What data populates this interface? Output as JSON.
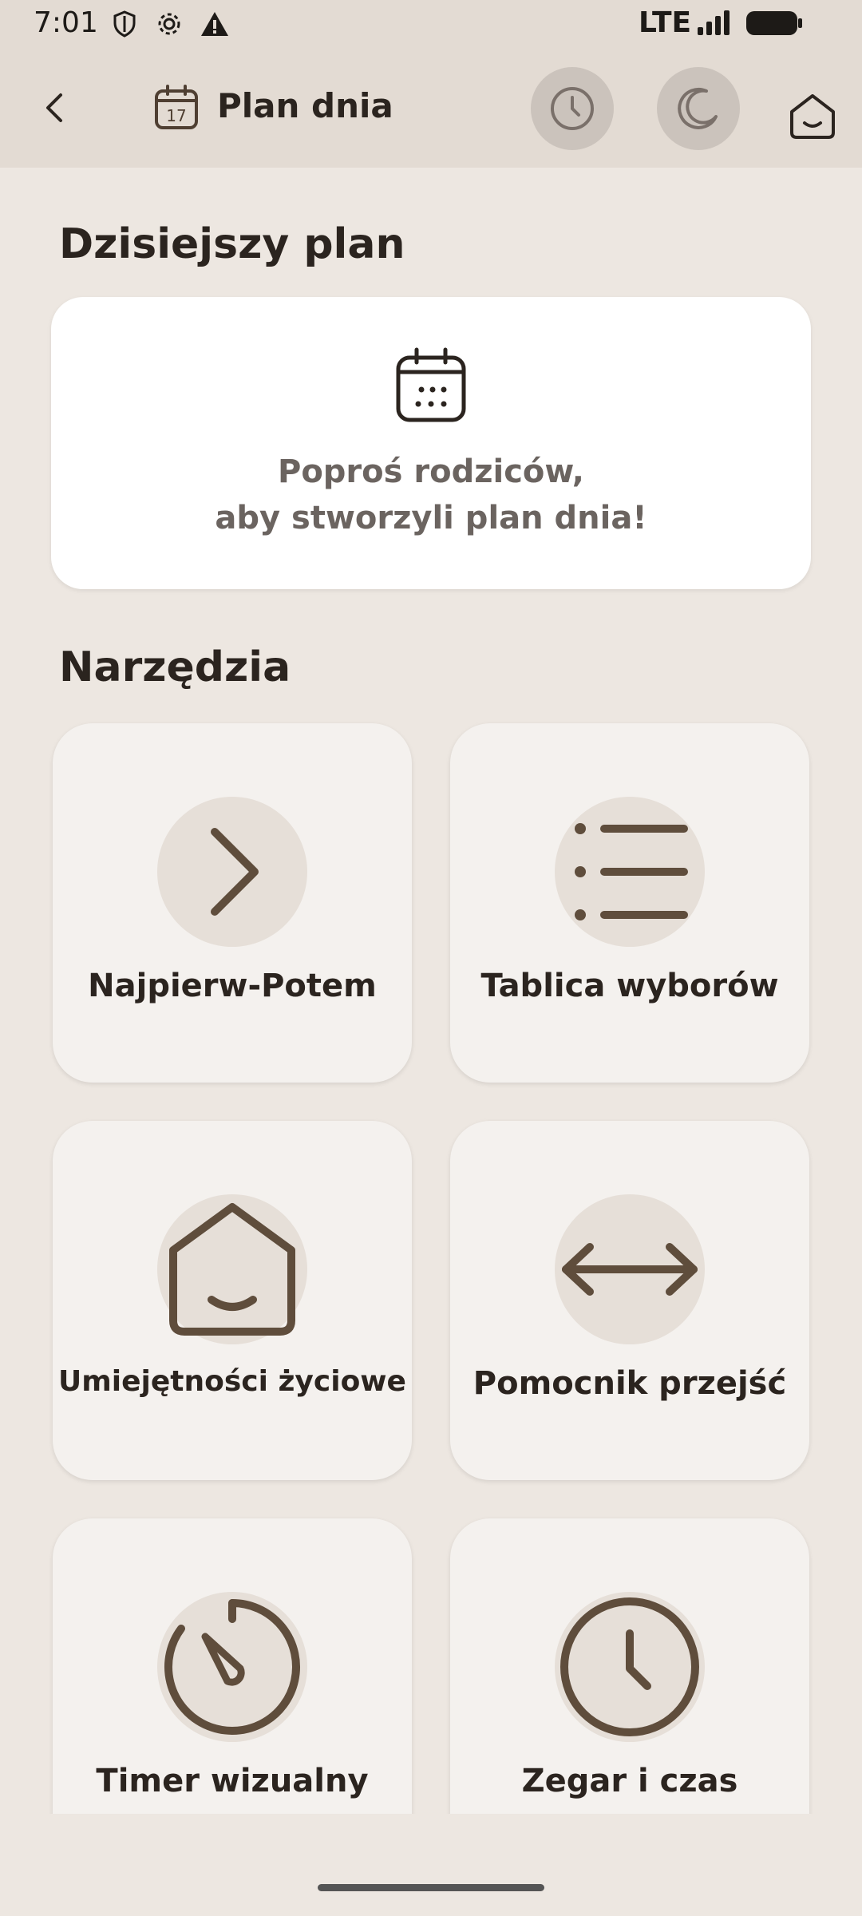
{
  "status_bar": {
    "time": "7:01",
    "network": "LTE"
  },
  "app_bar": {
    "title": "Plan dnia",
    "calendar_day": "17"
  },
  "today": {
    "heading": "Dzisiejszy plan",
    "empty_message_line1": "Poproś rodziców,",
    "empty_message_line2": "aby stworzyli plan dnia!"
  },
  "tools": {
    "heading": "Narzędzia",
    "items": [
      {
        "label": "Najpierw-Potem",
        "icon": "chevron-right-icon"
      },
      {
        "label": "Tablica wyborów",
        "icon": "list-icon"
      },
      {
        "label": "Umiejętności życiowe",
        "icon": "home-smile-icon"
      },
      {
        "label": "Pomocnik przejść",
        "icon": "double-arrow-icon"
      },
      {
        "label": "Timer wizualny",
        "icon": "timer-icon"
      },
      {
        "label": "Zegar i czas",
        "icon": "clock-icon"
      }
    ]
  },
  "colors": {
    "background": "#ede7e1",
    "appbar": "#e3dbd3",
    "icon": "#5f4d3c",
    "card": "#f4f1ee"
  }
}
